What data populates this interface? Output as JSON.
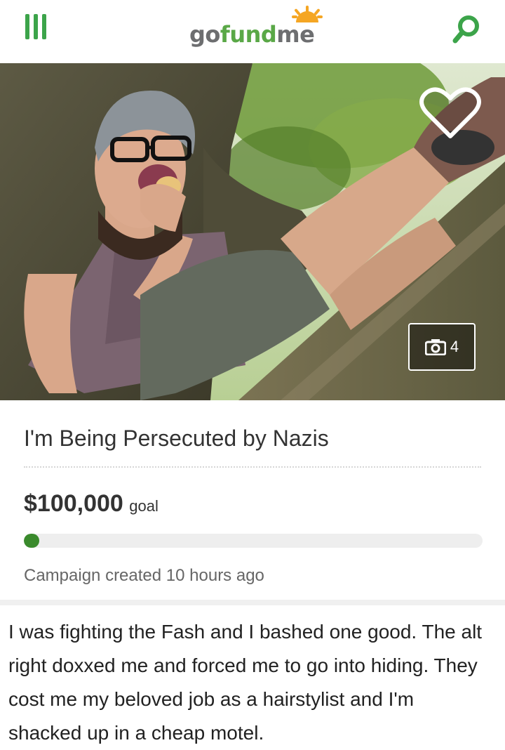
{
  "header": {
    "logo": {
      "go": "go",
      "fund": "fund",
      "me": "me"
    },
    "menu_icon": "hamburger-menu-icon",
    "search_icon": "search-icon",
    "accent_color": "#3ca44a"
  },
  "hero": {
    "favorite_icon": "heart-outline-icon",
    "photo_count_icon": "camera-icon",
    "photo_count": "4"
  },
  "campaign": {
    "title": "I'm Being Persecuted by Nazis",
    "goal_amount": "$100,000",
    "goal_label": "goal",
    "progress_fraction": 0.0,
    "created_text": "Campaign created 10 hours ago",
    "story": "I was fighting the Fash and I bashed one good. The alt right doxxed me and forced me to go into hiding. They cost me my beloved job as a hairstylist and I'm shacked up in a cheap motel."
  }
}
